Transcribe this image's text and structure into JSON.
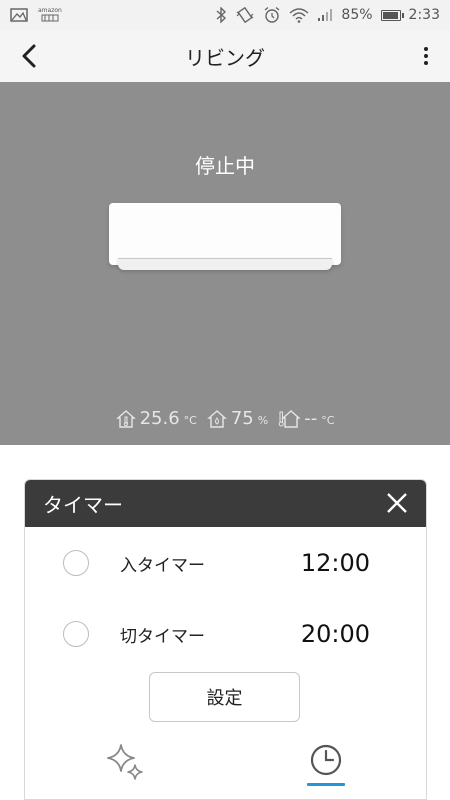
{
  "status_bar": {
    "battery": "85%",
    "time": "2:33",
    "icons": [
      "gallery-icon",
      "amazon-icon",
      "bluetooth-icon",
      "vibrate-icon",
      "alarm-icon",
      "wifi-icon",
      "signal-icon",
      "battery-icon"
    ],
    "battery_level": 0.85,
    "amazon_text": "amazon"
  },
  "app_bar": {
    "title": "リビング"
  },
  "hero": {
    "status": "停止中",
    "indoor_temp": "25.6",
    "indoor_temp_unit": "°C",
    "humidity": "75",
    "humidity_unit": "%",
    "outdoor_temp": "--",
    "outdoor_temp_unit": "°C",
    "background_color": "#8e8e8e"
  },
  "timer": {
    "title": "タイマー",
    "rows": [
      {
        "label": "入タイマー",
        "time": "12:00"
      },
      {
        "label": "切タイマー",
        "time": "20:00"
      }
    ],
    "set_label": "設定",
    "header_color": "#3b3b3b",
    "accent_color": "#2196d8"
  }
}
